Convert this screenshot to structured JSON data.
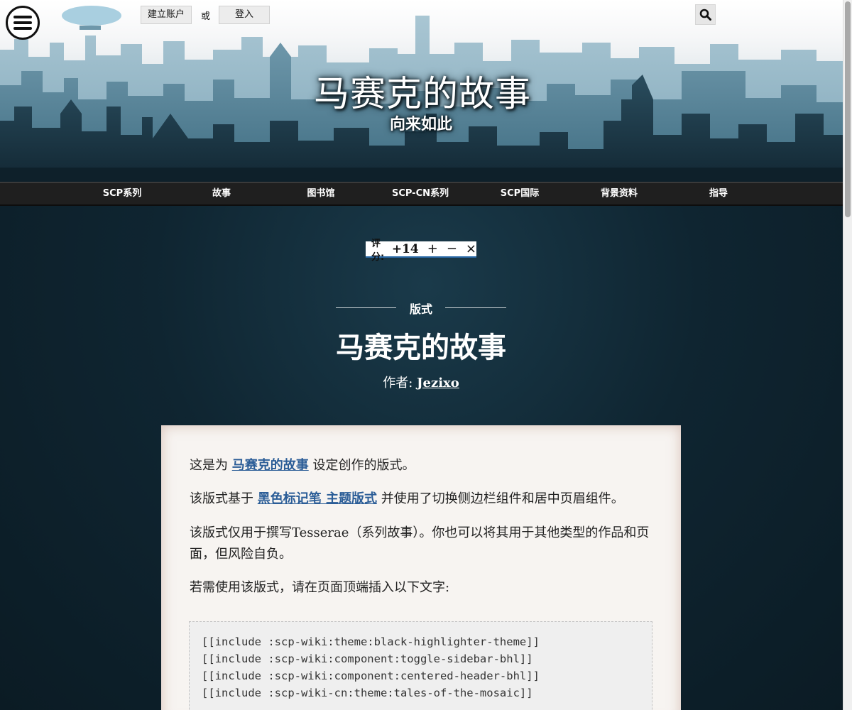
{
  "header": {
    "create_account": "建立账户",
    "or": "或",
    "sign_in": "登入",
    "site_title": "马赛克的故事",
    "site_subtitle": "向来如此"
  },
  "nav": {
    "items": [
      {
        "label": "SCP系列"
      },
      {
        "label": "故事"
      },
      {
        "label": "图书馆"
      },
      {
        "label": "SCP-CN系列"
      },
      {
        "label": "SCP国际"
      },
      {
        "label": "背景资料"
      },
      {
        "label": "指导"
      }
    ]
  },
  "rating": {
    "label": "评分:",
    "value": "+14",
    "upvote": "+",
    "downvote": "−",
    "cancel": "×"
  },
  "page": {
    "category": "版式",
    "title": "马赛克的故事",
    "author_prefix": "作者:",
    "author": "Jezixo"
  },
  "content": {
    "p1_pre": "这是为 ",
    "p1_link": "马赛克的故事",
    "p1_post": " 设定创作的版式。",
    "p2_pre": "该版式基于 ",
    "p2_link": "黑色标记笔 主题版式",
    "p2_post": " 并使用了切换侧边栏组件和居中页眉组件。",
    "p3": "该版式仅用于撰写Tesserae（系列故事）。你也可以将其用于其他类型的作品和页面，但风险自负。",
    "p4": "若需使用该版式，请在页面顶端插入以下文字:",
    "code": [
      "[[include :scp-wiki:theme:black-highlighter-theme]]",
      "[[include :scp-wiki:component:toggle-sidebar-bhl]]",
      "[[include :scp-wiki:component:centered-header-bhl]]",
      "[[include :scp-wiki-cn:theme:tales-of-the-mosaic]]"
    ]
  },
  "colors": {
    "link": "#2b5d97",
    "nav_bg": "#1f1f1f",
    "body_bg": "#0f2531",
    "card_bg": "#f7f4f1"
  }
}
